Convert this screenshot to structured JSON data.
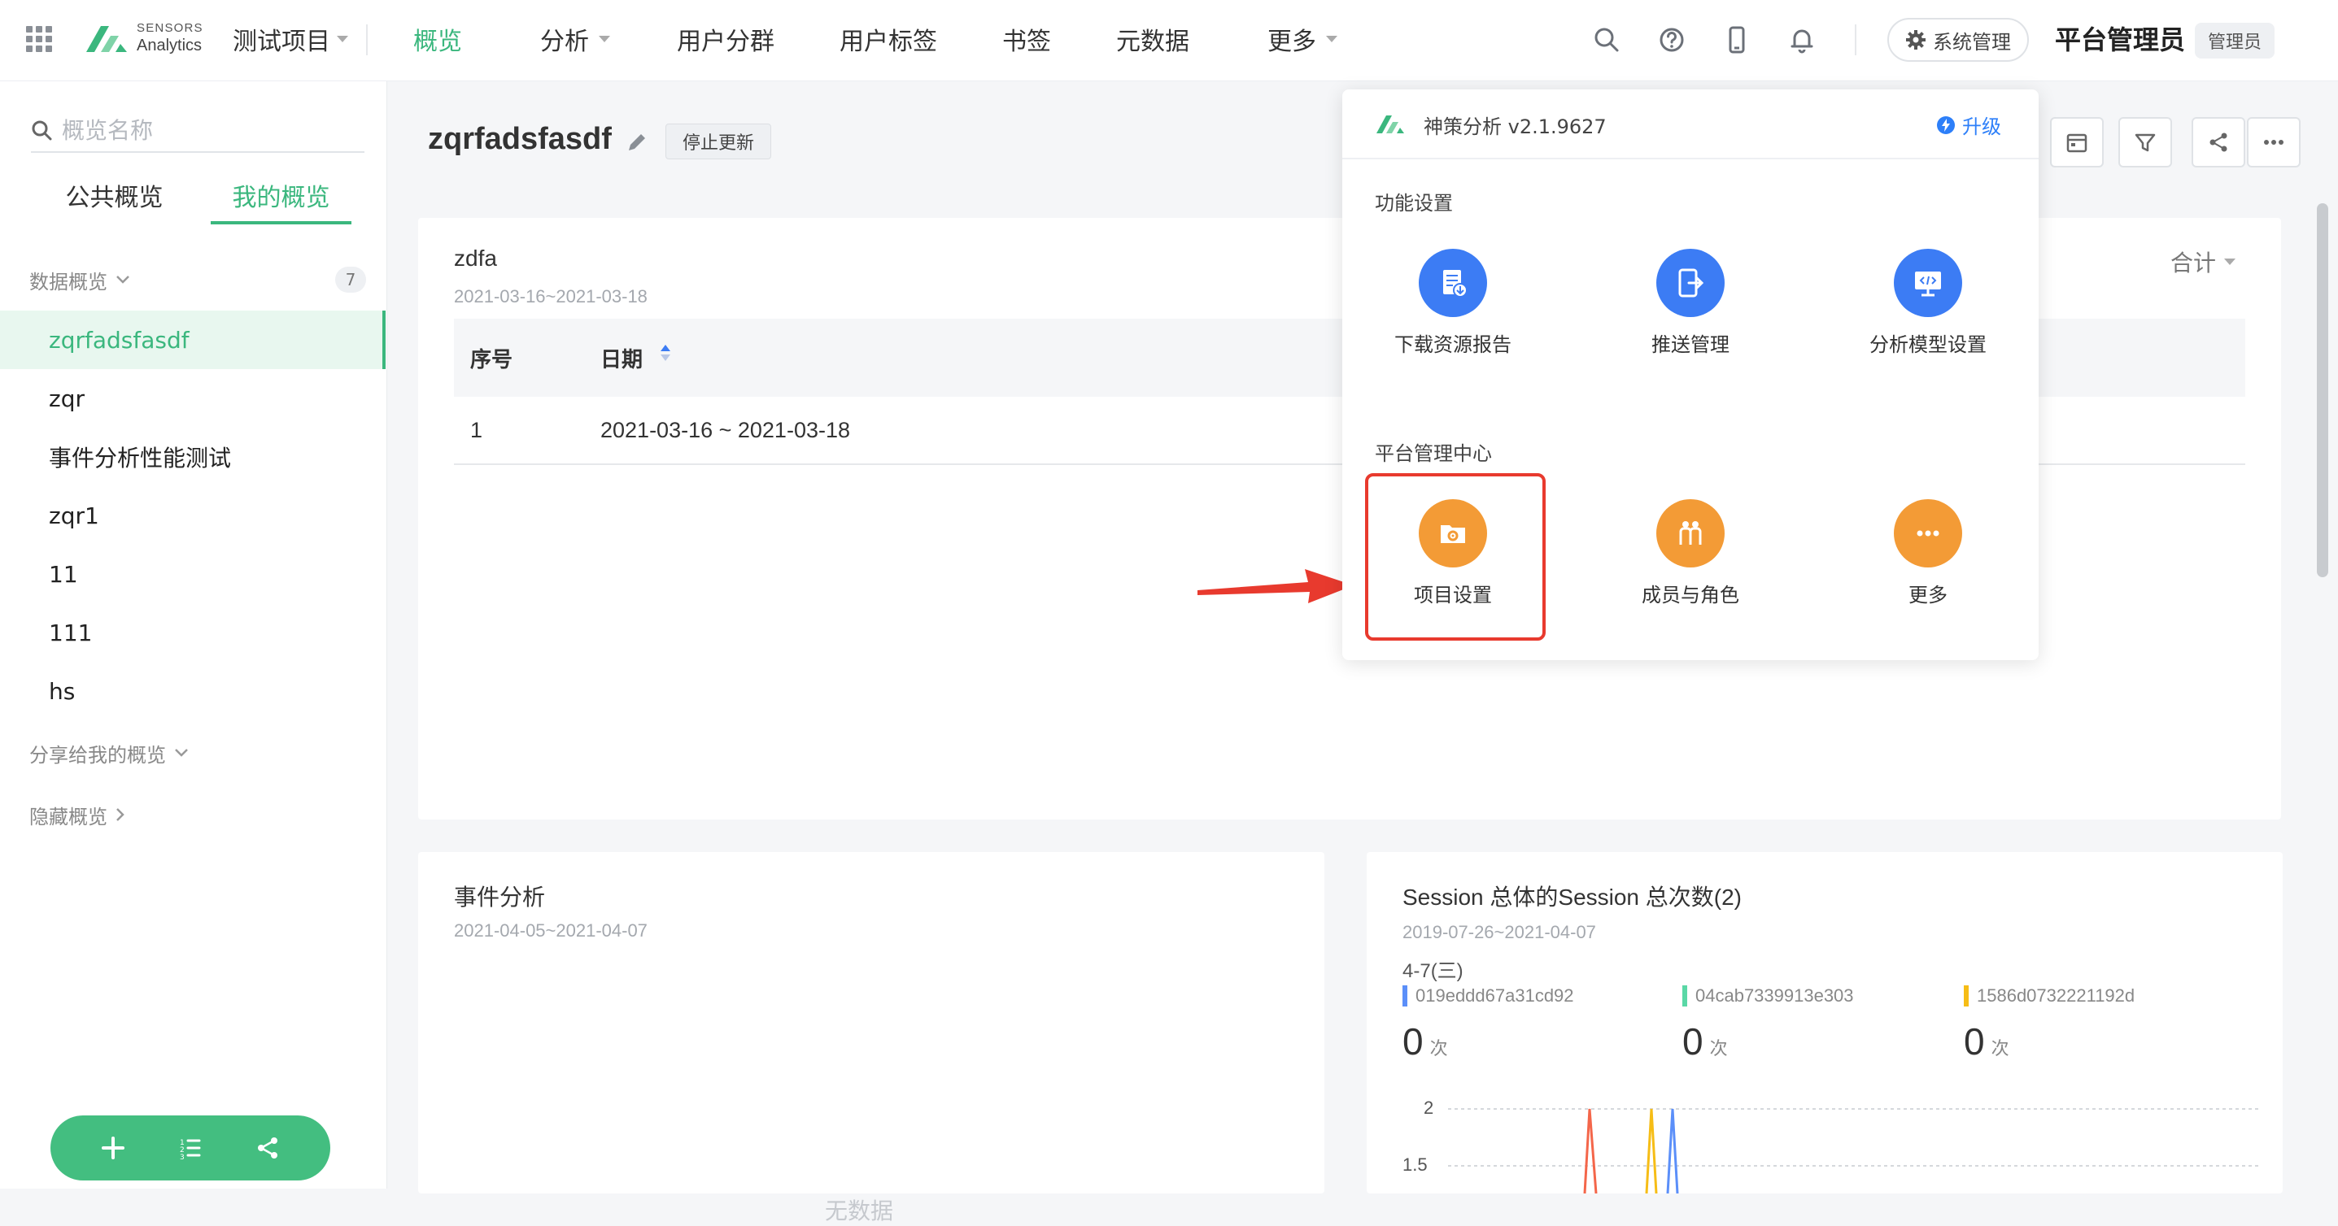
{
  "header": {
    "logo_top": "SENSORS",
    "logo_bottom": "Analytics",
    "project": "测试项目",
    "nav": [
      {
        "label": "概览"
      },
      {
        "label": "分析"
      },
      {
        "label": "用户分群"
      },
      {
        "label": "用户标签"
      },
      {
        "label": "书签"
      },
      {
        "label": "元数据"
      },
      {
        "label": "更多"
      }
    ],
    "system_button": "系统管理",
    "user_name": "平台管理员",
    "role": "管理员"
  },
  "sidebar": {
    "search_placeholder": "概览名称",
    "tabs": [
      {
        "label": "公共概览"
      },
      {
        "label": "我的概览"
      }
    ],
    "group_data": "数据概览",
    "group_count": "7",
    "items": [
      {
        "label": "zqrfadsfasdf"
      },
      {
        "label": "zqr"
      },
      {
        "label": "事件分析性能测试"
      },
      {
        "label": "zqr1"
      },
      {
        "label": "11"
      },
      {
        "label": "111"
      },
      {
        "label": "hs"
      }
    ],
    "group_shared": "分享给我的概览",
    "group_hidden": "隐藏概览"
  },
  "main": {
    "title": "zqrfadsfasdf",
    "stop_update": "停止更新"
  },
  "card1": {
    "title": "zdfa",
    "date_range": "2021-03-16~2021-03-18",
    "sum_label": "合计",
    "columns": [
      "序号",
      "日期"
    ],
    "rows": [
      {
        "index": "1",
        "date": "2021-03-16 ~ 2021-03-18"
      }
    ]
  },
  "card2": {
    "title": "事件分析",
    "date_range": "2021-04-05~2021-04-07",
    "empty": "无数据"
  },
  "card3": {
    "title": "Session 总体的Session 总次数(2)",
    "date_range": "2019-07-26~2021-04-07",
    "date": "4-7(三)",
    "series": [
      {
        "name": "019eddd67a31cd92",
        "value": "0",
        "unit": "次",
        "color": "#5b8ff9"
      },
      {
        "name": "04cab7339913e303",
        "value": "0",
        "unit": "次",
        "color": "#5ad8a6"
      },
      {
        "name": "1586d0732221192d",
        "value": "0",
        "unit": "次",
        "color": "#f6bd16"
      }
    ],
    "y_ticks": [
      "2",
      "1.5"
    ]
  },
  "popup": {
    "version": "神策分析 v2.1.9627",
    "upgrade": "升级",
    "section1": "功能设置",
    "functions": [
      {
        "label": "下载资源报告",
        "icon": "report-download-icon"
      },
      {
        "label": "推送管理",
        "icon": "push-icon"
      },
      {
        "label": "分析模型设置",
        "icon": "model-settings-icon"
      }
    ],
    "section2": "平台管理中心",
    "admin": [
      {
        "label": "项目设置",
        "icon": "project-settings-icon"
      },
      {
        "label": "成员与角色",
        "icon": "members-icon"
      },
      {
        "label": "更多",
        "icon": "more-icon"
      }
    ]
  },
  "colors": {
    "brand_green": "#3bb77e",
    "accent_blue": "#3c7cf4",
    "accent_orange": "#f39b36",
    "highlight_red": "#e83a2e"
  }
}
